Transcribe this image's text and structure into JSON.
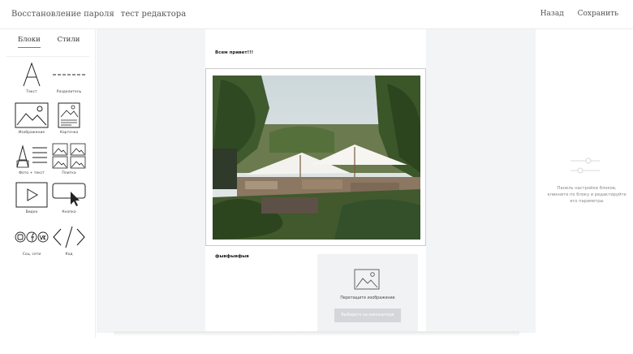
{
  "header": {
    "title": "Восстановление пароля",
    "subtitle": "тест редактора",
    "back_label": "Назад",
    "save_label": "Сохранить"
  },
  "sidebar": {
    "tabs": [
      {
        "label": "Блоки",
        "active": true
      },
      {
        "label": "Стили",
        "active": false
      }
    ],
    "blocks": [
      {
        "label": "Текст",
        "icon": "text-icon"
      },
      {
        "label": "Разделитель",
        "icon": "divider-icon"
      },
      {
        "label": "Изображение",
        "icon": "image-icon"
      },
      {
        "label": "Карточка",
        "icon": "card-icon"
      },
      {
        "label": "Фото + текст",
        "icon": "photo-text-icon"
      },
      {
        "label": "Плитка",
        "icon": "tiles-icon"
      },
      {
        "label": "Видео",
        "icon": "video-icon"
      },
      {
        "label": "Кнопка",
        "icon": "button-icon"
      },
      {
        "label": "Соц. сети",
        "icon": "social-icon"
      },
      {
        "label": "Код",
        "icon": "code-icon"
      }
    ]
  },
  "canvas": {
    "greeting": "Всем привет!!!",
    "text_block": "фывфывфыв",
    "dropzone_text": "Перетащите изображение",
    "dropzone_button": "Выберите на компьютере"
  },
  "right_panel": {
    "hint": "Панель настройки блоков, кликните по блоку и редактируйте его параметры"
  },
  "colors": {
    "accent": "#4a7fe0",
    "canvas_bg": "#f3f4f6"
  }
}
